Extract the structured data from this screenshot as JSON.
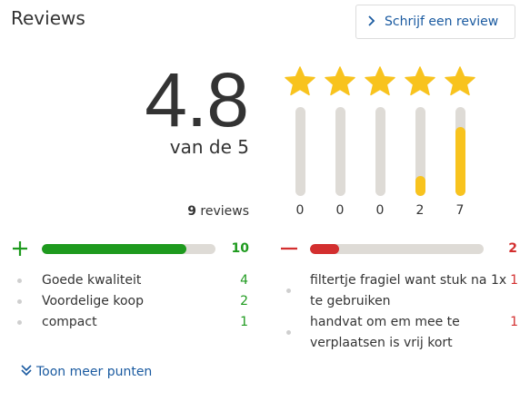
{
  "header": {
    "title": "Reviews",
    "write_review_label": "Schrijf een review"
  },
  "rating": {
    "score": "4.8",
    "out_of": "van de 5",
    "review_count": "9",
    "review_count_suffix": "reviews"
  },
  "distribution": [
    {
      "stars": 1,
      "count": "0",
      "fraction": 0.0
    },
    {
      "stars": 2,
      "count": "0",
      "fraction": 0.0
    },
    {
      "stars": 3,
      "count": "0",
      "fraction": 0.0
    },
    {
      "stars": 4,
      "count": "2",
      "fraction": 0.22
    },
    {
      "stars": 5,
      "count": "7",
      "fraction": 0.78
    }
  ],
  "pros": {
    "total": "10",
    "fraction": 0.83,
    "items": [
      {
        "label": "Goede kwaliteit",
        "count": "4"
      },
      {
        "label": "Voordelige koop",
        "count": "2"
      },
      {
        "label": "compact",
        "count": "1"
      }
    ]
  },
  "cons": {
    "total": "2",
    "fraction": 0.17,
    "items": [
      {
        "line1": "filtertje fragiel want stuk na 1x",
        "line2": "te gebruiken",
        "count": "1"
      },
      {
        "line1": "handvat om em mee te",
        "line2": "verplaatsen is vrij kort",
        "count": "1"
      }
    ]
  },
  "more_label": "Toon meer punten",
  "colors": {
    "star": "#f8c31e",
    "positive": "#1e9a1e",
    "negative": "#d32f2f",
    "link": "#1a5aa0",
    "track": "#dedbd6"
  },
  "icons": {
    "write": "chevron-right-icon",
    "pros": "plus-icon",
    "cons": "minus-icon",
    "more": "double-chevron-down-icon"
  }
}
